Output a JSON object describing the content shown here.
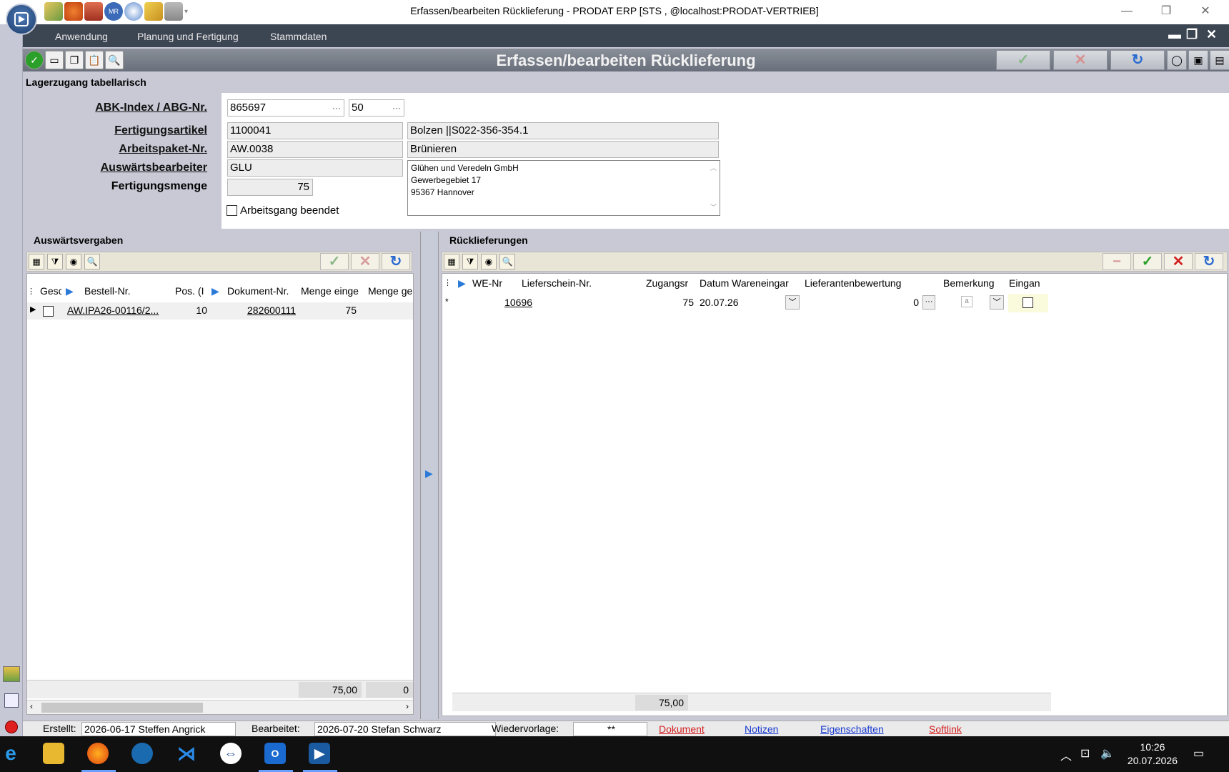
{
  "window": {
    "title": "Erfassen/bearbeiten Rücklieferung - PRODAT ERP   [STS , @localhost:PRODAT-VERTRIEB]",
    "minimize": "—",
    "restore": "❐",
    "close": "✕"
  },
  "menu": {
    "items": [
      "Anwendung",
      "Planung und Fertigung",
      "Stammdaten"
    ]
  },
  "form": {
    "title": "Erfassen/bearbeiten Rücklieferung",
    "ok_icon": "check-icon",
    "cancel_icon": "x-icon",
    "refresh_icon": "refresh-icon"
  },
  "header": {
    "section_title": "Lagerzugang tabellarisch",
    "labels": {
      "abk": "ABK-Index / ABG-Nr.",
      "artikel": "Fertigungsartikel",
      "arbeitspaket": "Arbeitspaket-Nr.",
      "bearbeiter": "Auswärtsbearbeiter",
      "menge": "Fertigungsmenge"
    },
    "abk_index": "865697",
    "abg_nr": "50",
    "artikel_nr": "1100041",
    "artikel_name": "Bolzen    ||S022-356-354.1",
    "arbeitspaket_nr": "AW.0038",
    "arbeitspaket_name": "Brünieren",
    "bearbeiter_code": "GLU",
    "address": [
      "Glühen und Veredeln GmbH",
      "Gewerbegebiet 17",
      "95367 Hannover"
    ],
    "fertigungsmenge": "75",
    "arbeitsgang_beendet_label": "Arbeitsgang beendet",
    "arbeitsgang_beendet": false
  },
  "left_panel": {
    "title": "Auswärtsvergaben",
    "columns": [
      "Gesc",
      "Bestell-Nr.",
      "Pos. (I",
      "Dokument-Nr.",
      "Menge einge",
      "Menge ge"
    ],
    "rows": [
      {
        "gesc": false,
        "bestell_nr": "AW.IPA26-00116/2...",
        "pos": "10",
        "dokument_nr": "282600111",
        "menge_eingegangen": "75",
        "menge_ge": ""
      }
    ],
    "sum_menge": "75,00",
    "sum_menge2": "0"
  },
  "right_panel": {
    "title": "Rücklieferungen",
    "columns": [
      "WE-Nr",
      "Lieferschein-Nr.",
      "Zugangsr",
      "Datum Wareneingar",
      "Lieferantenbewertung",
      "Bemerkung",
      "Eingan"
    ],
    "rows": [
      {
        "we_nr": "10696",
        "lieferschein_nr": "",
        "zugang": "75",
        "datum": "20.07.26",
        "bewertung": "0",
        "bemerkung": "a",
        "eingang": false
      }
    ],
    "sum_zugang": "75,00"
  },
  "status": {
    "erstellt_label": "Erstellt:",
    "erstellt_value": "2026-06-17  Steffen Angrick",
    "bearbeitet_label": "Bearbeitet:",
    "bearbeitet_value": "2026-07-20  Stefan Schwarz",
    "wiedervorlage_label": "Wiedervorlage:",
    "wiedervorlage_value": "**",
    "links": [
      "Dokument",
      "Notizen",
      "Eigenschaften",
      "Softlink"
    ],
    "link_colors": [
      "#d42020",
      "#1a3cd0",
      "#1a3cd0",
      "#d42020"
    ]
  },
  "taskbar": {
    "time": "10:26",
    "date": "20.07.2026"
  }
}
